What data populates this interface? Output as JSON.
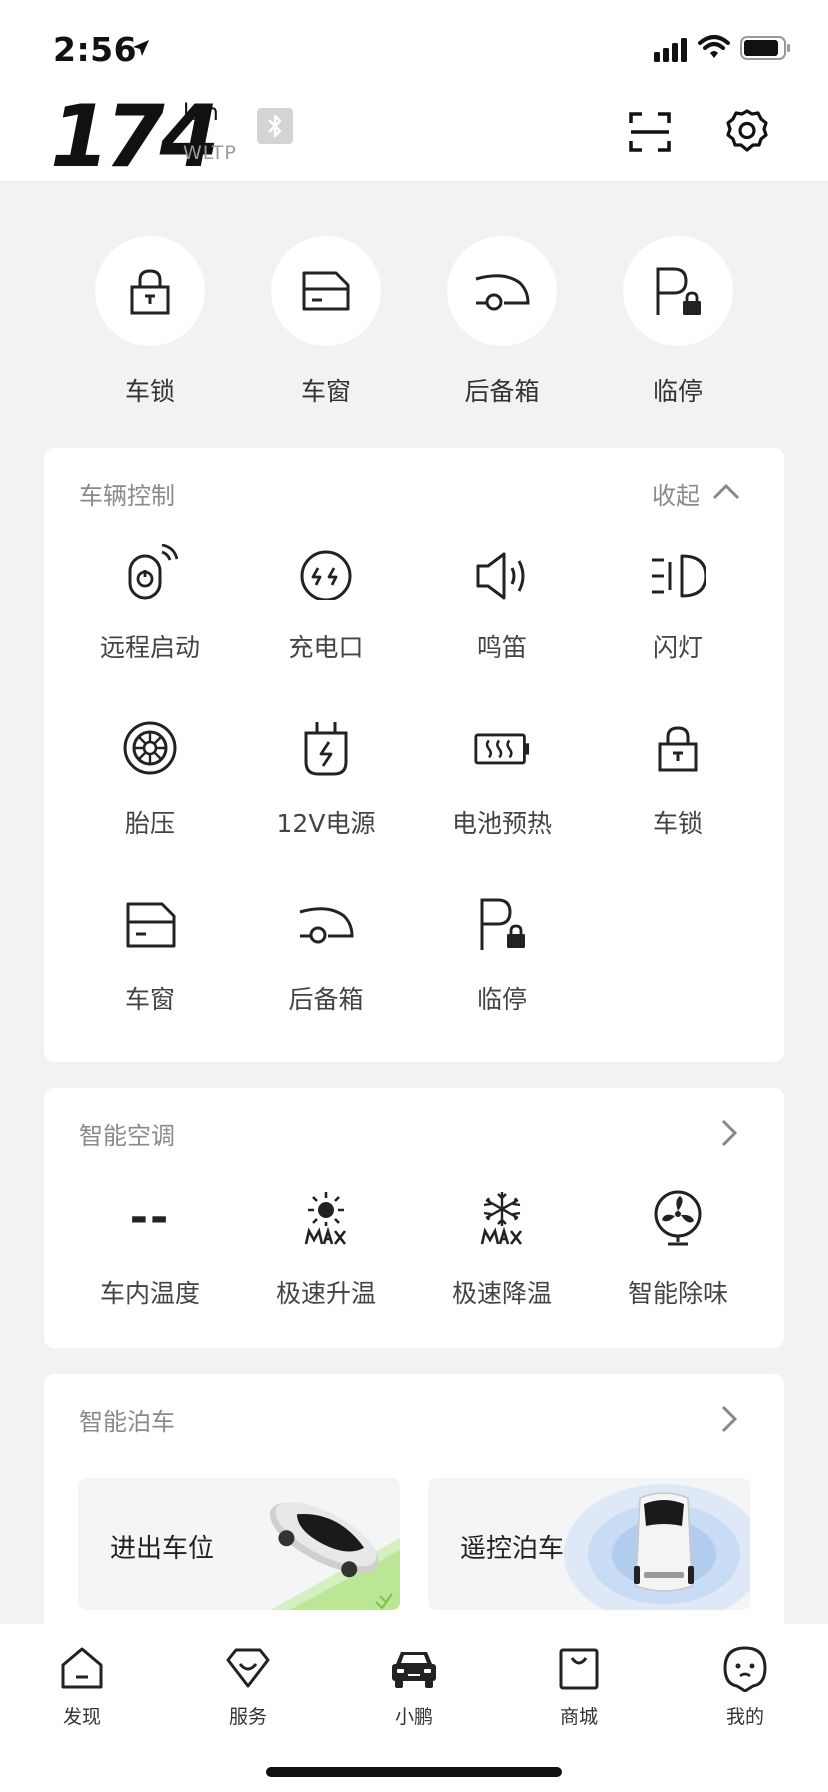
{
  "status_bar": {
    "time": "2:56"
  },
  "header": {
    "range_value": "174",
    "range_unit": "km",
    "range_standard": "WLTP"
  },
  "quick_actions": [
    {
      "label": "车锁",
      "icon": "lock-icon"
    },
    {
      "label": "车窗",
      "icon": "window-icon"
    },
    {
      "label": "后备箱",
      "icon": "trunk-icon"
    },
    {
      "label": "临停",
      "icon": "temp-parking-icon"
    }
  ],
  "vehicle_control": {
    "title": "车辆控制",
    "collapse_label": "收起",
    "items": [
      {
        "label": "远程启动",
        "icon": "remote-start-icon"
      },
      {
        "label": "充电口",
        "icon": "charge-port-icon"
      },
      {
        "label": "鸣笛",
        "icon": "horn-icon"
      },
      {
        "label": "闪灯",
        "icon": "flash-light-icon"
      },
      {
        "label": "胎压",
        "icon": "tire-pressure-icon"
      },
      {
        "label": "12V电源",
        "icon": "power-12v-icon"
      },
      {
        "label": "电池预热",
        "icon": "battery-preheat-icon"
      },
      {
        "label": "车锁",
        "icon": "lock-icon"
      },
      {
        "label": "车窗",
        "icon": "window-icon"
      },
      {
        "label": "后备箱",
        "icon": "trunk-icon"
      },
      {
        "label": "临停",
        "icon": "temp-parking-icon"
      }
    ]
  },
  "smart_ac": {
    "title": "智能空调",
    "cabin_temp_value": "--",
    "items": [
      {
        "label": "车内温度",
        "icon": "cabin-temp-icon"
      },
      {
        "label": "极速升温",
        "icon": "max-heat-icon"
      },
      {
        "label": "极速降温",
        "icon": "max-cool-icon"
      },
      {
        "label": "智能除味",
        "icon": "deodorize-fan-icon"
      }
    ]
  },
  "smart_parking": {
    "title": "智能泊车",
    "tiles": [
      {
        "label": "进出车位"
      },
      {
        "label": "遥控泊车"
      }
    ]
  },
  "tab_bar": [
    {
      "label": "发现",
      "icon": "discover-icon",
      "active": false
    },
    {
      "label": "服务",
      "icon": "service-icon",
      "active": false
    },
    {
      "label": "小鹏",
      "icon": "car-icon",
      "active": true
    },
    {
      "label": "商城",
      "icon": "store-icon",
      "active": false
    },
    {
      "label": "我的",
      "icon": "profile-icon",
      "active": false
    }
  ],
  "colors": {
    "background": "#f2f2f2",
    "card": "#ffffff",
    "icon_stroke": "#222222",
    "muted_text": "#8a8a8a",
    "parking_green": "#a8e07a",
    "parking_blue": "#c9dcf5"
  }
}
